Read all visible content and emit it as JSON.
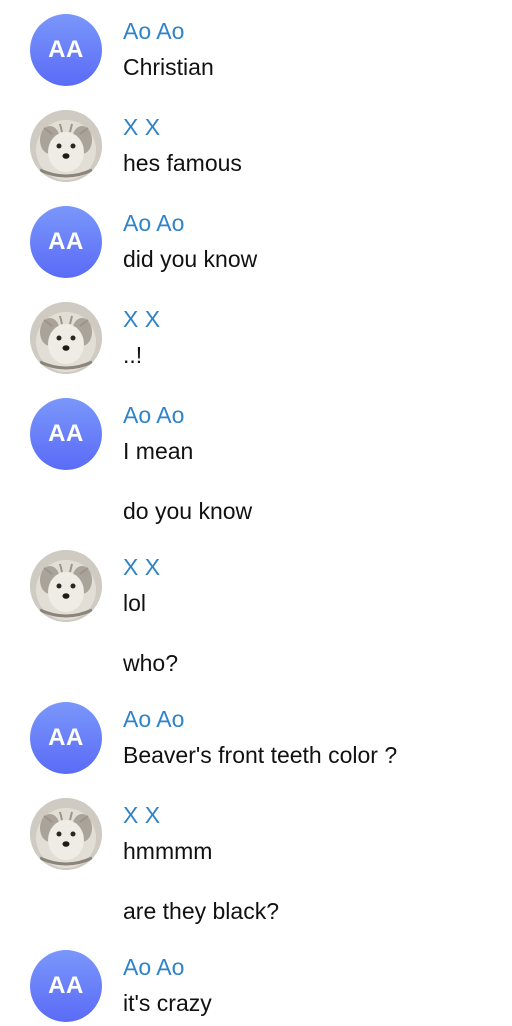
{
  "conversation": {
    "ao": {
      "name": "Ao Ao",
      "initials": "AA",
      "avatar_colors": [
        "#7a97fb",
        "#5b6bf7"
      ]
    },
    "xx": {
      "name": "X X",
      "avatar_icon": "dog-photo-icon"
    },
    "name_color": "#2f84c9",
    "messages": [
      {
        "sender": "Ao Ao",
        "lines": [
          "Christian"
        ]
      },
      {
        "sender": "X X",
        "lines": [
          "hes famous"
        ]
      },
      {
        "sender": "Ao Ao",
        "lines": [
          "did you know"
        ]
      },
      {
        "sender": "X X",
        "lines": [
          "..!"
        ]
      },
      {
        "sender": "Ao Ao",
        "lines": [
          "I mean",
          "do you know"
        ]
      },
      {
        "sender": "X X",
        "lines": [
          "lol",
          "who?"
        ]
      },
      {
        "sender": "Ao Ao",
        "lines": [
          "Beaver's front teeth color ?"
        ]
      },
      {
        "sender": "X X",
        "lines": [
          "hmmmm",
          "are they black?"
        ]
      },
      {
        "sender": "Ao Ao",
        "lines": [
          "it's crazy"
        ]
      }
    ]
  }
}
